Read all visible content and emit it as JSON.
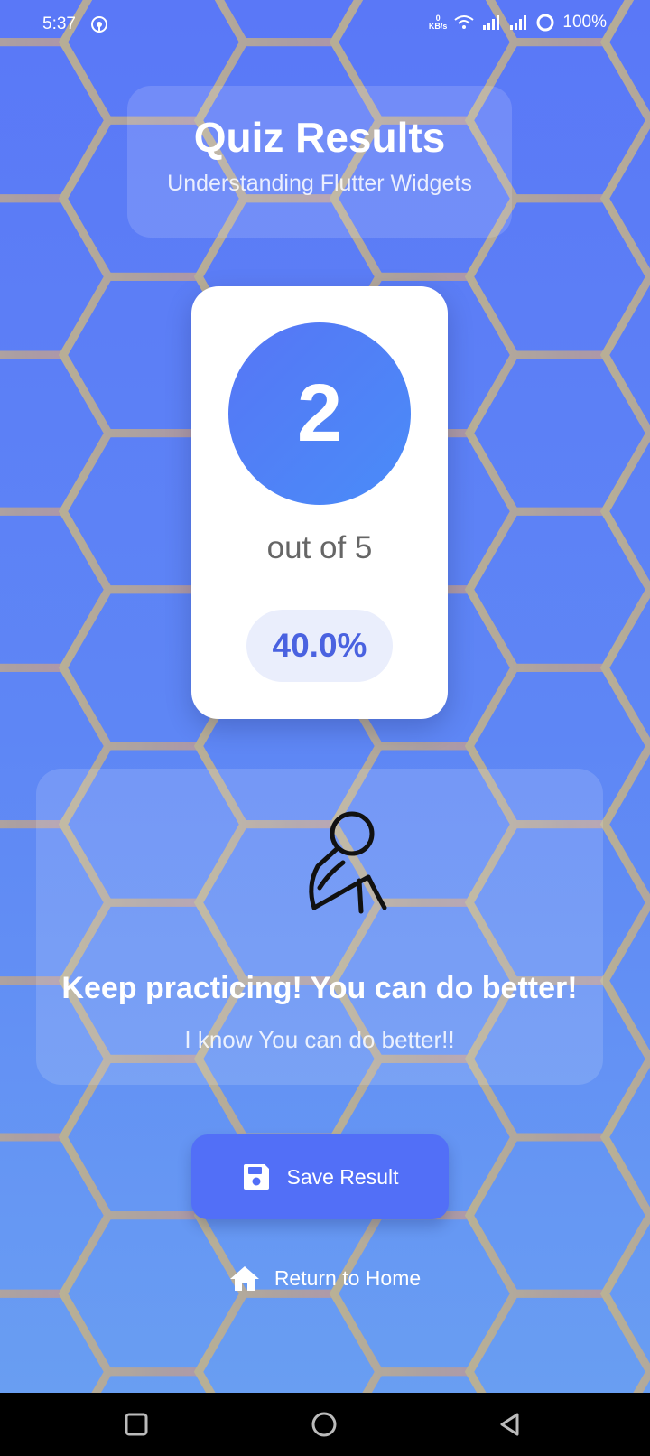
{
  "status_bar": {
    "time": "5:37",
    "net_speed_value": "0",
    "net_speed_unit": "KB/s",
    "battery": "100%"
  },
  "header": {
    "title": "Quiz Results",
    "subtitle": "Understanding Flutter Widgets"
  },
  "score": {
    "value": "2",
    "out_of": "out of 5",
    "percent": "40.0%"
  },
  "message": {
    "title": "Keep practicing! You can do better!",
    "subtitle": "I know You can do better!!"
  },
  "actions": {
    "save_label": "Save Result",
    "home_label": "Return to Home"
  },
  "icons": {
    "save": "floppy-disk-icon",
    "home": "home-icon",
    "figure": "sad-stick-figure-icon"
  },
  "colors": {
    "accent": "#526ff7",
    "percent_text": "#4a62e0",
    "hex_lines": "#c4b08a"
  }
}
